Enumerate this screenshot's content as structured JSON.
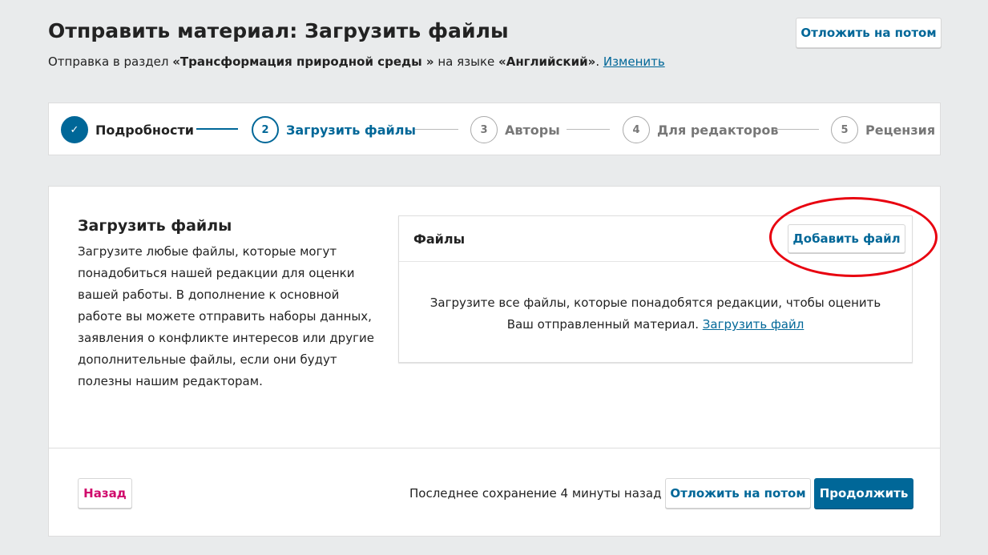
{
  "header": {
    "title": "Отправить материал: Загрузить файлы",
    "subtitle_prefix": "Отправка в раздел ",
    "section_name": "«Трансформация природной среды »",
    "subtitle_mid": " на языке ",
    "language": "«Английский»",
    "subtitle_dot": ". ",
    "change_link": "Изменить",
    "save_later": "Отложить на потом"
  },
  "steps": [
    {
      "num": "✓",
      "label": "Подробности",
      "state": "done"
    },
    {
      "num": "2",
      "label": "Загрузить файлы",
      "state": "current"
    },
    {
      "num": "3",
      "label": "Авторы",
      "state": "pending"
    },
    {
      "num": "4",
      "label": "Для редакторов",
      "state": "pending"
    },
    {
      "num": "5",
      "label": "Рецензия",
      "state": "pending"
    }
  ],
  "main": {
    "title": "Загрузить файлы",
    "description": "Загрузите любые файлы, которые могут понадобиться нашей редакции для оценки вашей работы. В дополнение к основной работе вы можете отправить наборы данных, заявления о конфликте интересов или другие дополнительные файлы, если они будут полезны нашим редакторам.",
    "files": {
      "title": "Файлы",
      "add_button": "Добавить файл",
      "empty_line1": "Загрузите все файлы, которые понадобятся редакции, чтобы оценить",
      "empty_line2": "Ваш отправленный материал. ",
      "upload_link": "Загрузить файл"
    }
  },
  "footer": {
    "back": "Назад",
    "last_saved": "Последнее сохранение 4 минуты назад",
    "save_later": "Отложить на потом",
    "continue": "Продолжить"
  },
  "colors": {
    "primary": "#006798",
    "back": "#d00a6c",
    "highlight": "#e8000f",
    "background": "#e9ebec"
  }
}
